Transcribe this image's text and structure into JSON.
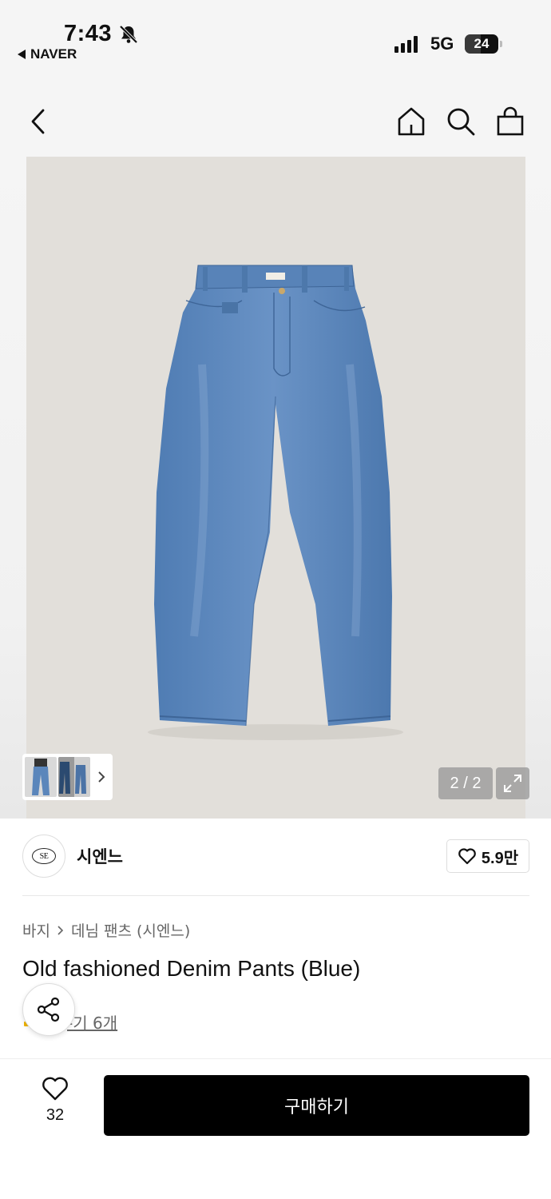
{
  "status_bar": {
    "time": "7:43",
    "back_app": "NAVER",
    "network": "5G",
    "battery": "24"
  },
  "nav": {
    "icons": [
      "chevron-left-icon",
      "home-icon",
      "search-icon",
      "shopping-bag-icon"
    ]
  },
  "gallery": {
    "page_counter": "2 / 2",
    "image_background": "#e2dfda",
    "denim_color": "#5b86bb"
  },
  "brand": {
    "logo_text": "SE",
    "name": "시엔느",
    "like_count": "5.9만"
  },
  "product": {
    "breadcrumb": [
      "바지",
      "데님 팬츠 (시엔느)"
    ],
    "title": "Old fashioned Denim Pants (Blue)",
    "review_label": "-기 6개"
  },
  "bottom_bar": {
    "wish_count": "32",
    "buy_label": "구매하기"
  }
}
